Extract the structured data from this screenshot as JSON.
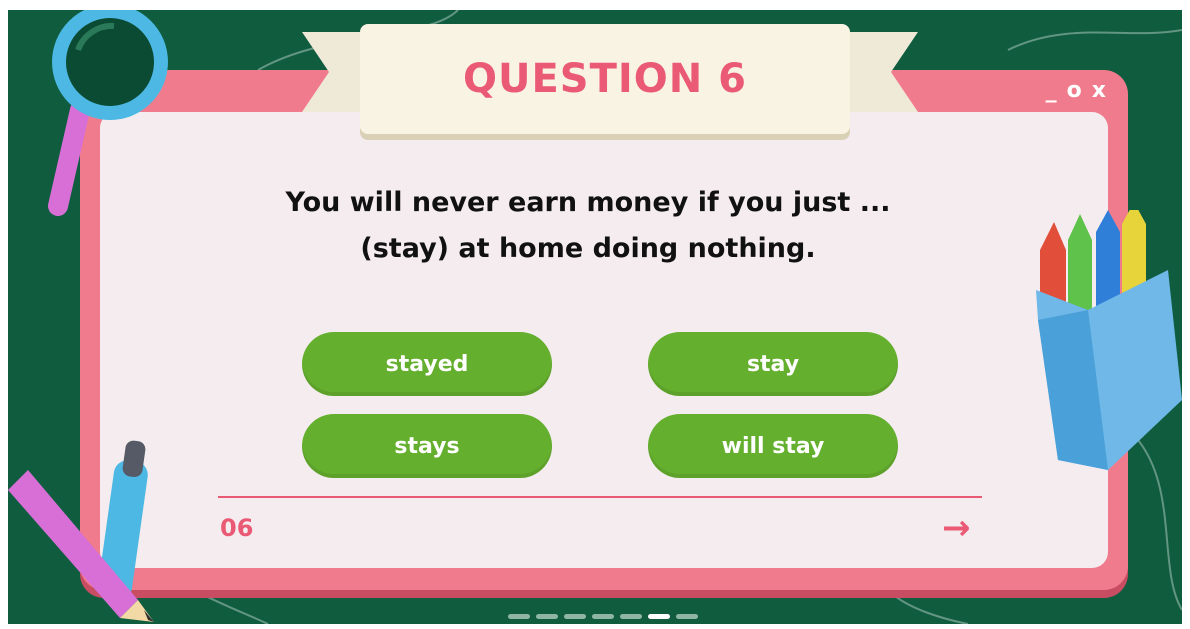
{
  "window": {
    "controls": [
      "_",
      "o",
      "x"
    ]
  },
  "banner": {
    "title": "QUESTION 6"
  },
  "question": {
    "line1": "You will never earn money if you just ...",
    "line2": "(stay) at home doing nothing."
  },
  "answers": [
    "stayed",
    "stay",
    "stays",
    "will stay"
  ],
  "footer": {
    "page_number": "06",
    "next_arrow": "→"
  },
  "pagination": {
    "total": 7,
    "active_index": 5
  },
  "colors": {
    "background": "#0f5c3f",
    "window_frame": "#f07b8c",
    "card": "#f4ecef",
    "accent": "#ea5a75",
    "answer_button": "#65af2f"
  },
  "decorations": [
    "magnifier-icon",
    "crayon-box-icon",
    "pen-icon",
    "pencil-icon"
  ]
}
